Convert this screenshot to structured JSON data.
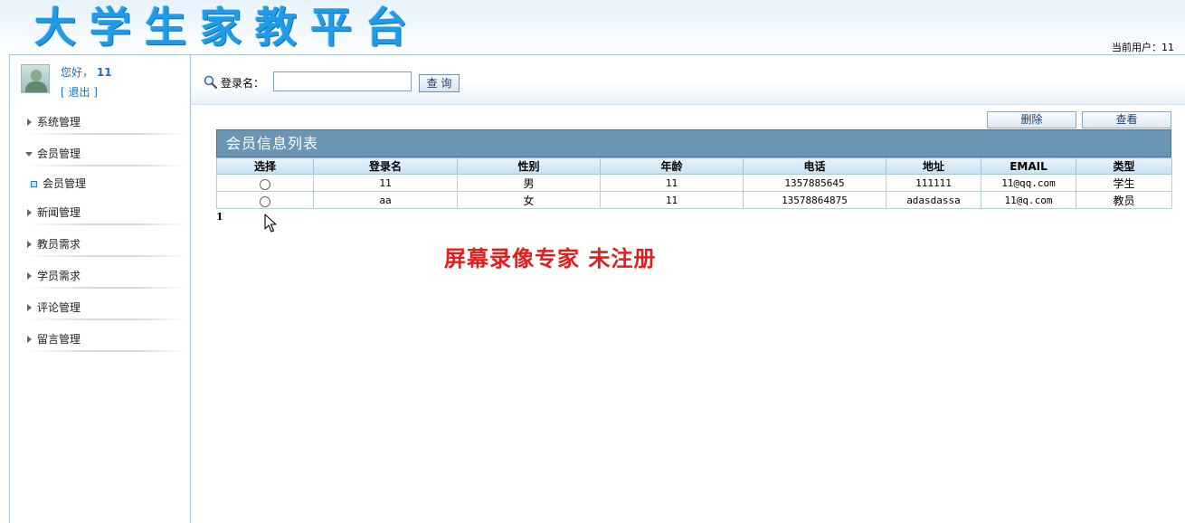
{
  "header": {
    "site_title": "大学生家教平台",
    "current_user_label": "当前用户：11"
  },
  "user": {
    "greeting": "您好，",
    "name": "11",
    "logout": "[  退出 ]"
  },
  "sidebar": {
    "items": [
      {
        "label": "系统管理",
        "expanded": false
      },
      {
        "label": "会员管理",
        "expanded": true,
        "children": [
          {
            "label": "会员管理"
          }
        ]
      },
      {
        "label": "新闻管理",
        "expanded": false
      },
      {
        "label": "教员需求",
        "expanded": false
      },
      {
        "label": "学员需求",
        "expanded": false
      },
      {
        "label": "评论管理",
        "expanded": false
      },
      {
        "label": "留言管理",
        "expanded": false
      }
    ]
  },
  "search": {
    "icon": "search-icon",
    "label": "登录名：",
    "value": "",
    "button_label": "查 询"
  },
  "actions": {
    "delete_label": "删除",
    "view_label": "查看"
  },
  "table": {
    "title": "会员信息列表",
    "columns": [
      "选择",
      "登录名",
      "性别",
      "年龄",
      "电话",
      "地址",
      "EMAIL",
      "类型"
    ],
    "rows": [
      {
        "login": "11",
        "gender": "男",
        "age": "11",
        "phone": "1357885645",
        "address": "111111",
        "email": "11@qq.com",
        "type": "学生"
      },
      {
        "login": "aa",
        "gender": "女",
        "age": "11",
        "phone": "13578864875",
        "address": "adasdassa",
        "email": "11@q.com",
        "type": "教员"
      }
    ],
    "page": "1"
  },
  "watermark": "屏幕录像专家  未注册",
  "colors": {
    "title_blue": "#1f9be8",
    "panel_header": "#6a96b6",
    "watermark_red": "#e81b1b"
  }
}
